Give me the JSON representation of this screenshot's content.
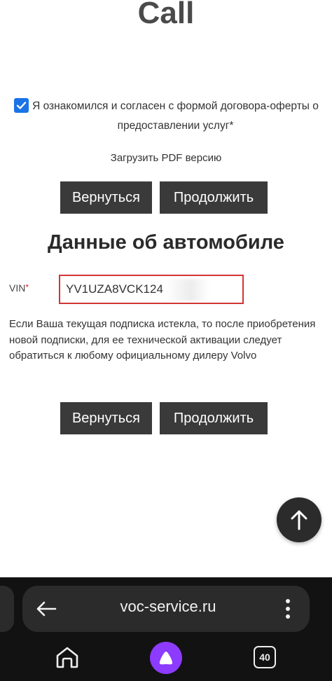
{
  "page": {
    "title": "Call"
  },
  "agreement": {
    "checked": true,
    "text": "Я ознакомился и согласен с формой договора-оферты о предоставлении услуг*"
  },
  "pdf_link": "Загрузить PDF версию",
  "buttons": {
    "back": "Вернуться",
    "continue": "Продолжить"
  },
  "car_section": {
    "title": "Данные об автомобиле",
    "vin_label": "VIN",
    "vin_required_mark": "*",
    "vin_value": "YV1UZA8VCK124",
    "notice": "Если Ваша текущая подписка истекла, то после приобретения новой подписки, для ее технической активации следует обратиться к любому официальному дилеру Volvo"
  },
  "browser": {
    "url": "voc-service.ru",
    "tab_count": "40",
    "alice_color": "#8c3bff"
  },
  "icons": [
    "check-icon",
    "arrow-up-icon",
    "back-arrow-icon",
    "kebab-menu-icon",
    "home-icon",
    "alice-icon",
    "tabs-counter-icon"
  ]
}
